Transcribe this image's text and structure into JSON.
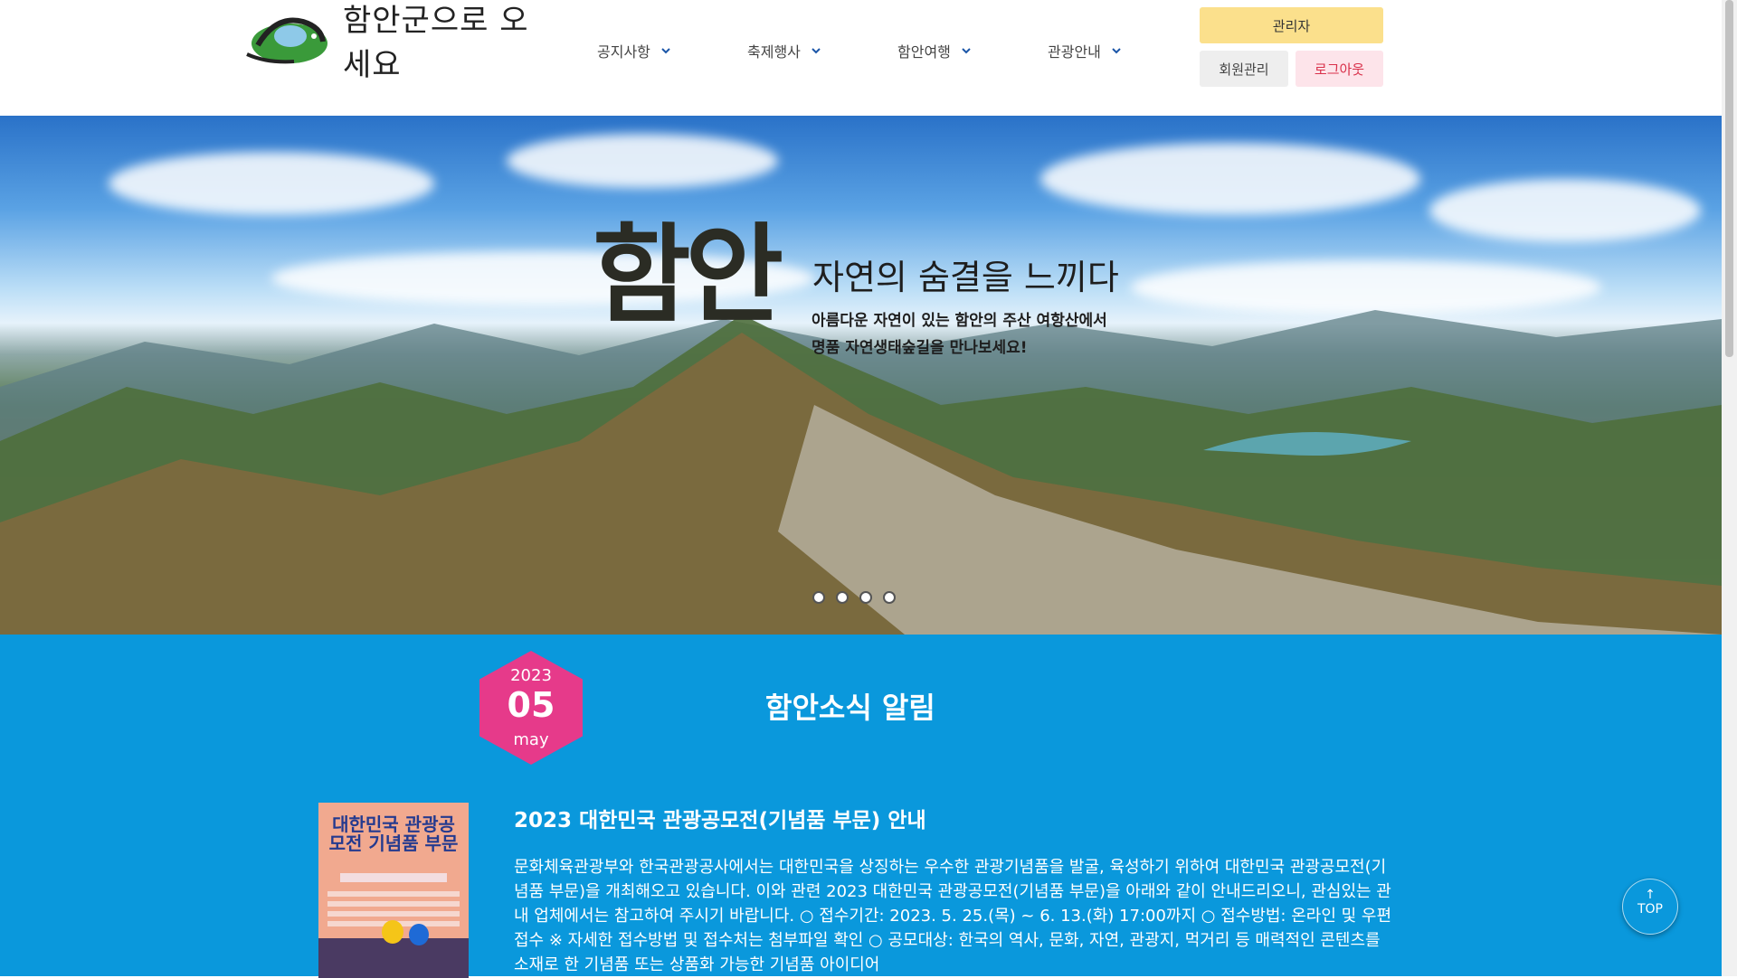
{
  "header": {
    "logo_text": "함안군으로 오세요",
    "nav": [
      {
        "label": "공지사항"
      },
      {
        "label": "축제행사"
      },
      {
        "label": "함안여행"
      },
      {
        "label": "관광안내"
      }
    ],
    "admin_label": "관리자",
    "members_label": "회원관리",
    "logout_label": "로그아웃"
  },
  "hero": {
    "brand": "함안",
    "title": "자연의 숨결을 느끼다",
    "desc_line1": "아름다운 자연이 있는 함안의 주산 여항산에서",
    "desc_line2": "명품 자연생태숲길을 만나보세요!",
    "slides": 4
  },
  "news": {
    "date_year": "2023",
    "date_day": "05",
    "date_month": "may",
    "section_title": "함안소식 알림",
    "poster_text": "대한민국 관광공모전 기념품 부문",
    "article_title": "2023 대한민국 관광공모전(기념품 부문) 안내",
    "article_body": "문화체육관광부와 한국관광공사에서는 대한민국을 상징하는 우수한 관광기념품을 발굴, 육성하기 위하여 대한민국 관광공모전(기념품 부문)을 개최해오고 있습니다. 이와 관련 2023 대한민국 관광공모전(기념품 부문)을 아래와 같이 안내드리오니, 관심있는 관내 업체에서는 참고하여 주시기 바랍니다. ○ 접수기간: 2023. 5. 25.(목) ~ 6. 13.(화) 17:00까지 ○ 접수방법: 온라인 및 우편접수 ※ 자세한 접수방법 및 접수처는 첨부파일 확인 ○ 공모대상: 한국의 역사, 문화, 자연, 관광지, 먹거리 등 매력적인 콘텐츠를 소재로 한 기념품 또는 상품화 가능한 기념품 아이디어"
  },
  "top_button": {
    "arrow": "↑",
    "label": "TOP"
  },
  "colors": {
    "news_bg": "#0a98dc",
    "date_badge": "#e63a8a",
    "admin_btn": "#fbe08c",
    "logout_text": "#d9304a"
  }
}
